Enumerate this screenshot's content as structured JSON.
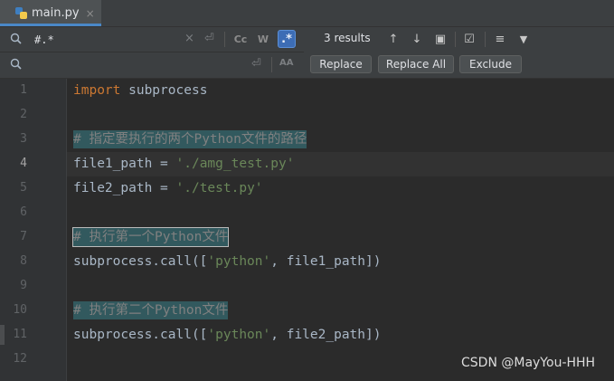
{
  "tab": {
    "label": "main.py",
    "close": "×"
  },
  "find": {
    "query": "#.*",
    "clear_icon": "×",
    "newline_icon": "⏎",
    "match_case": "Cc",
    "whole_word": "W",
    "regex": ".*",
    "results": "3 results",
    "prev_icon": "↑",
    "next_icon": "↓",
    "select_all_icon": "▣",
    "in_selection_icon": "☑",
    "multiline_icon": "≡",
    "filter_icon": "▼"
  },
  "replace": {
    "value": "",
    "newline_icon": "⏎",
    "preserve_case": "AA",
    "replace_label": "Replace",
    "replace_all_label": "Replace All",
    "exclude_label": "Exclude"
  },
  "editor": {
    "current_line": 4,
    "line_numbers": [
      "1",
      "2",
      "3",
      "4",
      "5",
      "6",
      "7",
      "8",
      "9",
      "10",
      "11",
      "12"
    ],
    "lines": {
      "l1_kw": "import",
      "l1_rest": " subprocess",
      "l3_cmt": "# 指定要执行的两个Python文件的路径",
      "l4_a": "file1_path = ",
      "l4_str": "'./amg_test.py'",
      "l5_a": "file2_path = ",
      "l5_str": "'./test.py'",
      "l7_cmt": "# 执行第一个Python文件",
      "l8_a": "subprocess.call([",
      "l8_str": "'python'",
      "l8_b": ", file1_path])",
      "l10_cmt": "# 执行第二个Python文件",
      "l11_a": "subprocess.call([",
      "l11_str": "'python'",
      "l11_b": ", file2_path])"
    }
  },
  "watermark": "CSDN @MayYou-HHH",
  "colors": {
    "accent": "#4a88c7",
    "keyword": "#cc7832",
    "string": "#6a8759",
    "comment": "#808080",
    "match_highlight": "#32595e"
  }
}
